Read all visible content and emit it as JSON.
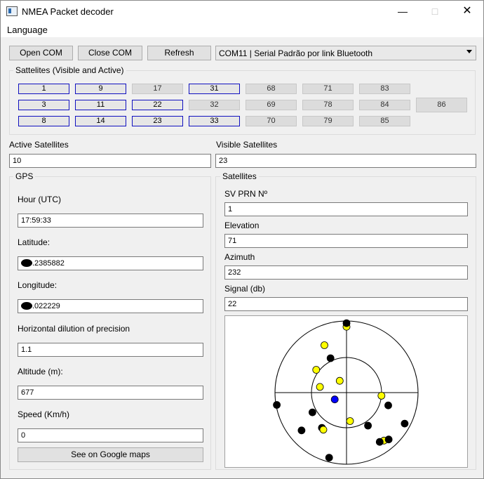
{
  "window": {
    "title": "NMEA Packet decoder"
  },
  "menu": {
    "language": "Language"
  },
  "toolbar": {
    "open_com": "Open COM",
    "close_com": "Close COM",
    "refresh": "Refresh",
    "port_selected": "COM11 | Serial Padrão por link Bluetooth"
  },
  "satellites_group": {
    "title": "Sattelites (Visible and Active)",
    "items": [
      {
        "id": "1",
        "active": true
      },
      {
        "id": "9",
        "active": true
      },
      {
        "id": "17",
        "active": false
      },
      {
        "id": "31",
        "active": true
      },
      {
        "id": "68",
        "active": false
      },
      {
        "id": "71",
        "active": false
      },
      {
        "id": "83",
        "active": false
      },
      {
        "id": "3",
        "active": true
      },
      {
        "id": "11",
        "active": true
      },
      {
        "id": "22",
        "active": true
      },
      {
        "id": "32",
        "active": false
      },
      {
        "id": "69",
        "active": false
      },
      {
        "id": "78",
        "active": false
      },
      {
        "id": "84",
        "active": false
      },
      {
        "id": "86",
        "active": false
      },
      {
        "id": "8",
        "active": true
      },
      {
        "id": "14",
        "active": true
      },
      {
        "id": "23",
        "active": true
      },
      {
        "id": "33",
        "active": true
      },
      {
        "id": "70",
        "active": false
      },
      {
        "id": "79",
        "active": false
      },
      {
        "id": "85",
        "active": false
      }
    ]
  },
  "counts": {
    "active_label": "Active Satellites",
    "active_value": "10",
    "visible_label": "Visible Satellites",
    "visible_value": "23"
  },
  "gps": {
    "title": "GPS",
    "hour_label": "Hour (UTC)",
    "hour_value": "17:59:33",
    "latitude_label": "Latitude:",
    "latitude_value": ".2385882",
    "longitude_label": "Longitude:",
    "longitude_value": ".022229",
    "hdop_label": "Horizontal dilution of precision",
    "hdop_value": "1.1",
    "altitude_label": "Altitude (m):",
    "altitude_value": "677",
    "speed_label": "Speed (Km/h)",
    "speed_value": "0",
    "maps_button": "See on Google maps"
  },
  "satellite_detail": {
    "title": "Satellites",
    "prn_label": "SV PRN Nº",
    "prn_value": "1",
    "elevation_label": "Elevation",
    "elevation_value": "71",
    "azimuth_label": "Azimuth",
    "azimuth_value": "232",
    "signal_label": "Signal (db)",
    "signal_value": "22"
  },
  "skyplot": {
    "colors": {
      "selected": "#0000ff",
      "active": "#ffff00",
      "visible": "#000000"
    },
    "points": [
      {
        "az": 0,
        "el": 0.08,
        "kind": "active"
      },
      {
        "az": 0,
        "el": 0.03,
        "kind": "visible"
      },
      {
        "az": 335,
        "el": 0.27,
        "kind": "active"
      },
      {
        "az": 307,
        "el": 0.47,
        "kind": "active"
      },
      {
        "az": 335,
        "el": 0.47,
        "kind": "visible"
      },
      {
        "az": 282,
        "el": 0.62,
        "kind": "active"
      },
      {
        "az": 330,
        "el": 0.81,
        "kind": "active"
      },
      {
        "az": 240,
        "el": 0.81,
        "kind": "selected"
      },
      {
        "az": 260,
        "el": 0.01,
        "kind": "visible"
      },
      {
        "az": 240,
        "el": 0.45,
        "kind": "visible"
      },
      {
        "az": 215,
        "el": 0.4,
        "kind": "visible"
      },
      {
        "az": 212,
        "el": 0.39,
        "kind": "active"
      },
      {
        "az": 230,
        "el": 0.18,
        "kind": "visible"
      },
      {
        "az": 195,
        "el": 0.06,
        "kind": "visible"
      },
      {
        "az": 173,
        "el": 0.6,
        "kind": "active"
      },
      {
        "az": 147,
        "el": 0.45,
        "kind": "visible"
      },
      {
        "az": 95,
        "el": 0.51,
        "kind": "active"
      },
      {
        "az": 107,
        "el": 0.39,
        "kind": "visible"
      },
      {
        "az": 118,
        "el": 0.08,
        "kind": "visible"
      },
      {
        "az": 142,
        "el": 0.15,
        "kind": "active"
      },
      {
        "az": 138,
        "el": 0.12,
        "kind": "visible"
      },
      {
        "az": 146,
        "el": 0.17,
        "kind": "visible"
      }
    ]
  }
}
